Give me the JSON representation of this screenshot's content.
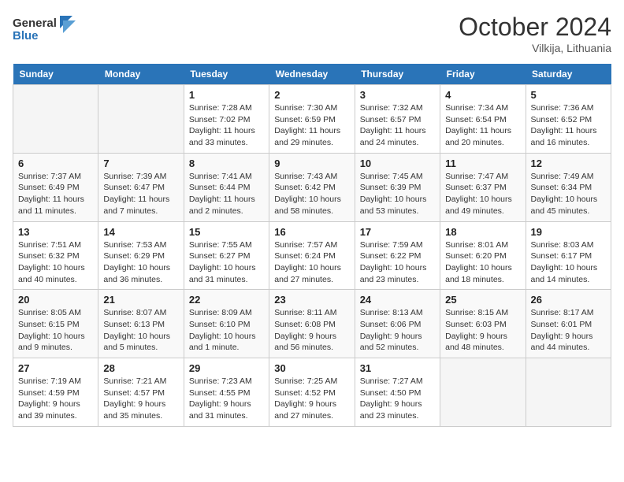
{
  "header": {
    "logo_general": "General",
    "logo_blue": "Blue",
    "month_year": "October 2024",
    "location": "Vilkija, Lithuania"
  },
  "days_of_week": [
    "Sunday",
    "Monday",
    "Tuesday",
    "Wednesday",
    "Thursday",
    "Friday",
    "Saturday"
  ],
  "weeks": [
    [
      {
        "day": "",
        "info": ""
      },
      {
        "day": "",
        "info": ""
      },
      {
        "day": "1",
        "info": "Sunrise: 7:28 AM\nSunset: 7:02 PM\nDaylight: 11 hours and 33 minutes."
      },
      {
        "day": "2",
        "info": "Sunrise: 7:30 AM\nSunset: 6:59 PM\nDaylight: 11 hours and 29 minutes."
      },
      {
        "day": "3",
        "info": "Sunrise: 7:32 AM\nSunset: 6:57 PM\nDaylight: 11 hours and 24 minutes."
      },
      {
        "day": "4",
        "info": "Sunrise: 7:34 AM\nSunset: 6:54 PM\nDaylight: 11 hours and 20 minutes."
      },
      {
        "day": "5",
        "info": "Sunrise: 7:36 AM\nSunset: 6:52 PM\nDaylight: 11 hours and 16 minutes."
      }
    ],
    [
      {
        "day": "6",
        "info": "Sunrise: 7:37 AM\nSunset: 6:49 PM\nDaylight: 11 hours and 11 minutes."
      },
      {
        "day": "7",
        "info": "Sunrise: 7:39 AM\nSunset: 6:47 PM\nDaylight: 11 hours and 7 minutes."
      },
      {
        "day": "8",
        "info": "Sunrise: 7:41 AM\nSunset: 6:44 PM\nDaylight: 11 hours and 2 minutes."
      },
      {
        "day": "9",
        "info": "Sunrise: 7:43 AM\nSunset: 6:42 PM\nDaylight: 10 hours and 58 minutes."
      },
      {
        "day": "10",
        "info": "Sunrise: 7:45 AM\nSunset: 6:39 PM\nDaylight: 10 hours and 53 minutes."
      },
      {
        "day": "11",
        "info": "Sunrise: 7:47 AM\nSunset: 6:37 PM\nDaylight: 10 hours and 49 minutes."
      },
      {
        "day": "12",
        "info": "Sunrise: 7:49 AM\nSunset: 6:34 PM\nDaylight: 10 hours and 45 minutes."
      }
    ],
    [
      {
        "day": "13",
        "info": "Sunrise: 7:51 AM\nSunset: 6:32 PM\nDaylight: 10 hours and 40 minutes."
      },
      {
        "day": "14",
        "info": "Sunrise: 7:53 AM\nSunset: 6:29 PM\nDaylight: 10 hours and 36 minutes."
      },
      {
        "day": "15",
        "info": "Sunrise: 7:55 AM\nSunset: 6:27 PM\nDaylight: 10 hours and 31 minutes."
      },
      {
        "day": "16",
        "info": "Sunrise: 7:57 AM\nSunset: 6:24 PM\nDaylight: 10 hours and 27 minutes."
      },
      {
        "day": "17",
        "info": "Sunrise: 7:59 AM\nSunset: 6:22 PM\nDaylight: 10 hours and 23 minutes."
      },
      {
        "day": "18",
        "info": "Sunrise: 8:01 AM\nSunset: 6:20 PM\nDaylight: 10 hours and 18 minutes."
      },
      {
        "day": "19",
        "info": "Sunrise: 8:03 AM\nSunset: 6:17 PM\nDaylight: 10 hours and 14 minutes."
      }
    ],
    [
      {
        "day": "20",
        "info": "Sunrise: 8:05 AM\nSunset: 6:15 PM\nDaylight: 10 hours and 9 minutes."
      },
      {
        "day": "21",
        "info": "Sunrise: 8:07 AM\nSunset: 6:13 PM\nDaylight: 10 hours and 5 minutes."
      },
      {
        "day": "22",
        "info": "Sunrise: 8:09 AM\nSunset: 6:10 PM\nDaylight: 10 hours and 1 minute."
      },
      {
        "day": "23",
        "info": "Sunrise: 8:11 AM\nSunset: 6:08 PM\nDaylight: 9 hours and 56 minutes."
      },
      {
        "day": "24",
        "info": "Sunrise: 8:13 AM\nSunset: 6:06 PM\nDaylight: 9 hours and 52 minutes."
      },
      {
        "day": "25",
        "info": "Sunrise: 8:15 AM\nSunset: 6:03 PM\nDaylight: 9 hours and 48 minutes."
      },
      {
        "day": "26",
        "info": "Sunrise: 8:17 AM\nSunset: 6:01 PM\nDaylight: 9 hours and 44 minutes."
      }
    ],
    [
      {
        "day": "27",
        "info": "Sunrise: 7:19 AM\nSunset: 4:59 PM\nDaylight: 9 hours and 39 minutes."
      },
      {
        "day": "28",
        "info": "Sunrise: 7:21 AM\nSunset: 4:57 PM\nDaylight: 9 hours and 35 minutes."
      },
      {
        "day": "29",
        "info": "Sunrise: 7:23 AM\nSunset: 4:55 PM\nDaylight: 9 hours and 31 minutes."
      },
      {
        "day": "30",
        "info": "Sunrise: 7:25 AM\nSunset: 4:52 PM\nDaylight: 9 hours and 27 minutes."
      },
      {
        "day": "31",
        "info": "Sunrise: 7:27 AM\nSunset: 4:50 PM\nDaylight: 9 hours and 23 minutes."
      },
      {
        "day": "",
        "info": ""
      },
      {
        "day": "",
        "info": ""
      }
    ]
  ]
}
